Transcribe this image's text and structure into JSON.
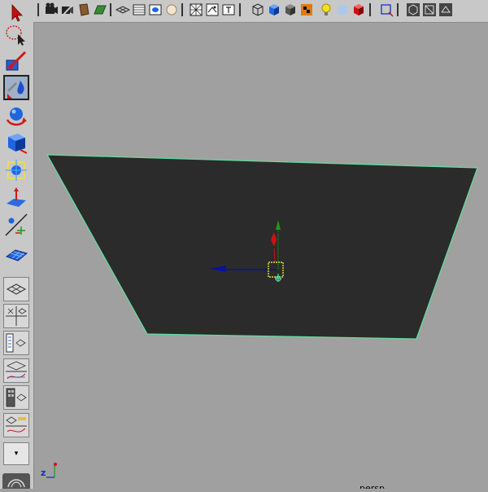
{
  "viewport": {
    "camera_label": "persp",
    "axis_label": "z"
  },
  "colors": {
    "plane_fill": "#2b2b2b",
    "plane_edge": "#60e0a0",
    "background": "#a0a0a0",
    "manip_x": "#0a10a0",
    "manip_y": "#1a9a1a",
    "manip_z": "#d01010",
    "selection": "#ffff40"
  },
  "left_toolbar": {
    "tools": [
      {
        "name": "select-tool",
        "icon": "arrow-icon"
      },
      {
        "name": "lasso-tool",
        "icon": "lasso-icon"
      },
      {
        "name": "paint-select-tool",
        "icon": "brush-icon"
      },
      {
        "name": "move-tool",
        "icon": "move-icon",
        "active": true
      },
      {
        "name": "rotate-tool",
        "icon": "rotate-icon"
      },
      {
        "name": "scale-tool",
        "icon": "scale-icon"
      },
      {
        "name": "universal-manipulator",
        "icon": "universal-manip-icon"
      },
      {
        "name": "soft-mod-tool",
        "icon": "softmod-icon"
      },
      {
        "name": "show-manipulator-tool",
        "icon": "manip-icon"
      },
      {
        "name": "last-tool",
        "icon": "plane-icon"
      }
    ],
    "layouts": [
      {
        "name": "single-perspective-layout"
      },
      {
        "name": "four-view-layout"
      },
      {
        "name": "outliner-persp-layout"
      },
      {
        "name": "persp-graph-layout"
      },
      {
        "name": "hypershade-persp-layout"
      },
      {
        "name": "persp-trax-layout"
      }
    ],
    "dropdown_glyph": "▾"
  },
  "top_toolbar": {
    "icons": [
      "select-camera-icon",
      "camera-attributes-icon",
      "bookmarks-icon",
      "image-plane-icon",
      "2d-pan-zoom-icon",
      "grid-icon",
      "film-gate-icon",
      "resolution-gate-icon",
      "gate-mask-icon",
      "field-chart-icon",
      "safe-action-icon",
      "safe-title-icon",
      "wireframe-icon",
      "smooth-shade-icon",
      "default-material-icon",
      "textured-icon",
      "lights-icon",
      "xray-icon",
      "xray-active-icon",
      "isolate-select-icon",
      "backface-icon",
      "screen-space-ao-icon",
      "motion-blur-icon"
    ]
  }
}
